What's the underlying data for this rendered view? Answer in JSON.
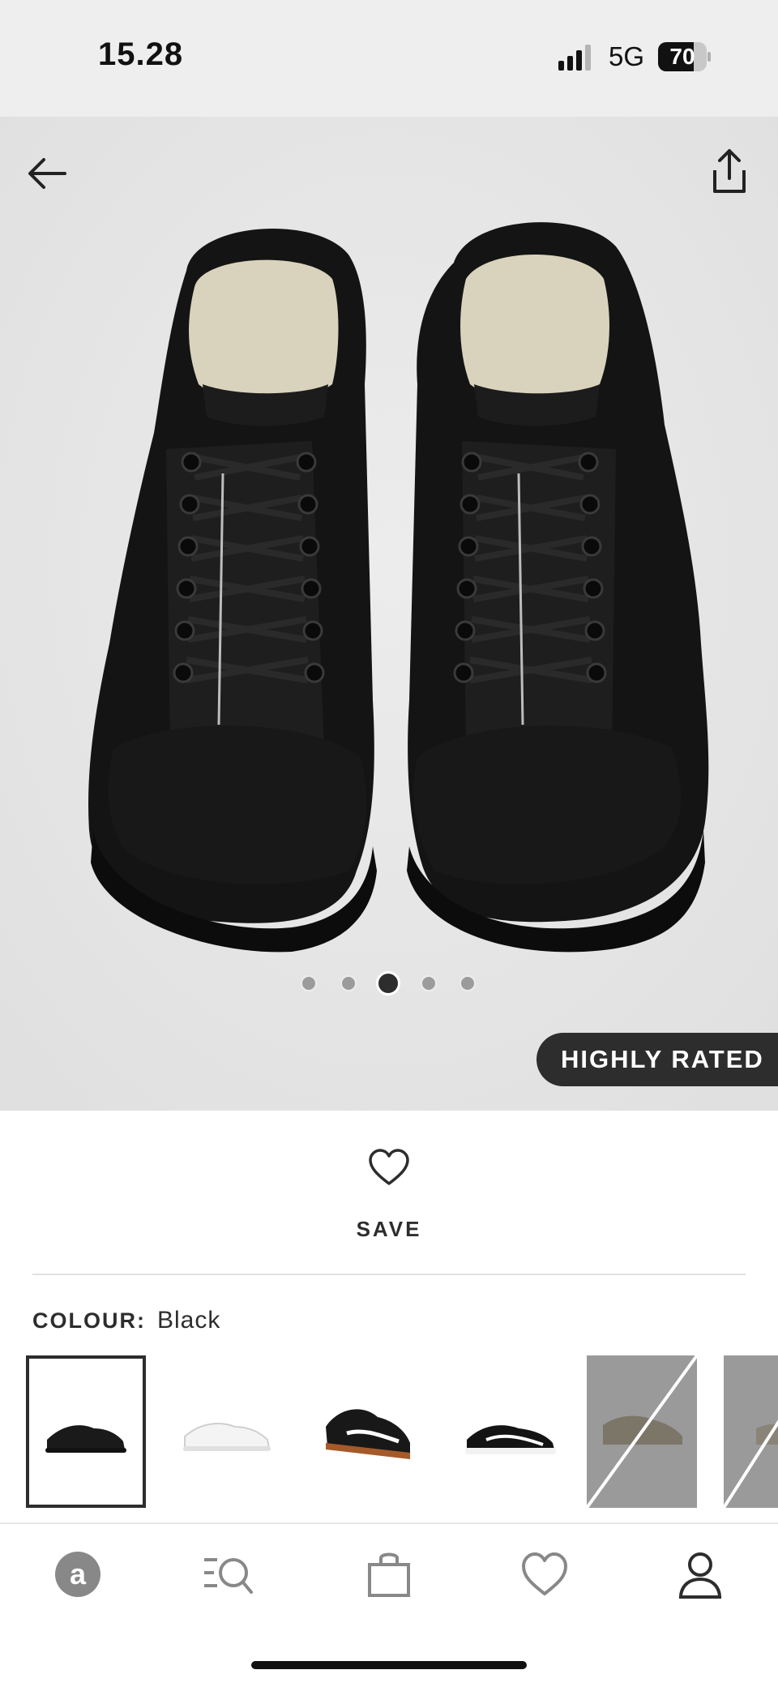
{
  "status_bar": {
    "time": "15.28",
    "network": "5G",
    "battery": "70"
  },
  "product": {
    "image_icon": "black-canvas-sneakers",
    "badge": "HIGHLY RATED",
    "gallery_count": 5,
    "gallery_active_index": 2
  },
  "save": {
    "label": "SAVE"
  },
  "colour": {
    "label": "COLOUR:",
    "value": "Black"
  },
  "swatches": [
    {
      "name": "black-mono",
      "available": true,
      "selected": true
    },
    {
      "name": "white-mono",
      "available": true,
      "selected": false
    },
    {
      "name": "black-gum",
      "available": true,
      "selected": false
    },
    {
      "name": "black-white",
      "available": true,
      "selected": false
    },
    {
      "name": "grey",
      "available": false,
      "selected": false
    },
    {
      "name": "grey-2",
      "available": false,
      "selected": false
    }
  ],
  "tab_bar": {
    "items": [
      "home-icon",
      "search-icon",
      "bag-icon",
      "saved-icon",
      "account-icon"
    ]
  },
  "colors": {
    "accent": "#2d2d2d",
    "status_bg": "#eeeeee"
  }
}
